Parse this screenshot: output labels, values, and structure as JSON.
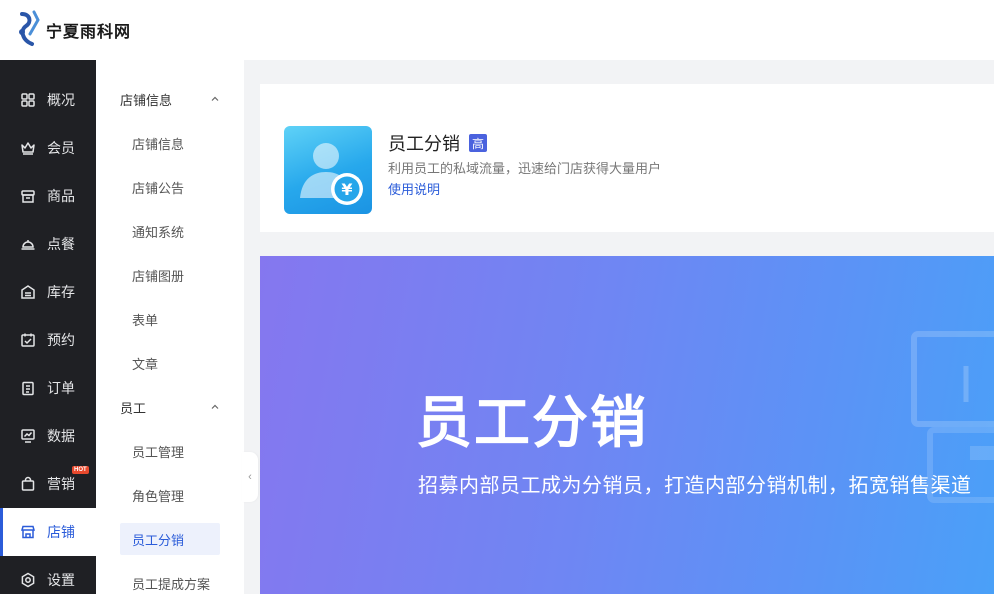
{
  "header": {
    "logo_text": "宁夏雨科网"
  },
  "primary_nav": [
    {
      "label": "概况",
      "icon": "grid-icon"
    },
    {
      "label": "会员",
      "icon": "crown-icon"
    },
    {
      "label": "商品",
      "icon": "store-icon"
    },
    {
      "label": "点餐",
      "icon": "cloche-icon"
    },
    {
      "label": "库存",
      "icon": "inventory-icon"
    },
    {
      "label": "预约",
      "icon": "calendar-check-icon"
    },
    {
      "label": "订单",
      "icon": "clipboard-icon"
    },
    {
      "label": "数据",
      "icon": "chart-monitor-icon"
    },
    {
      "label": "营销",
      "icon": "bag-icon",
      "badge": "HOT"
    },
    {
      "label": "店铺",
      "icon": "shop-icon",
      "active": true
    },
    {
      "label": "设置",
      "icon": "settings-icon"
    }
  ],
  "secondary_nav": {
    "groups": [
      {
        "label": "店铺信息",
        "items": [
          "店铺信息",
          "店铺公告",
          "通知系统",
          "店铺图册",
          "表单",
          "文章"
        ]
      },
      {
        "label": "员工",
        "items": [
          "员工管理",
          "角色管理",
          "员工分销",
          "员工提成方案"
        ]
      }
    ],
    "active_item": "员工分销"
  },
  "app_card": {
    "title": "员工分销",
    "level_badge": "高",
    "description": "利用员工的私域流量，迅速给门店获得大量用户",
    "link": "使用说明"
  },
  "banner": {
    "title": "员工分销",
    "subtitle": "招募内部员工成为分销员，打造内部分销机制，拓宽销售渠道"
  },
  "colors": {
    "accent": "#2b5cd9",
    "sidebar_bg": "#1f2024",
    "hot_badge": "#e8492d",
    "level_badge": "#4a62de"
  }
}
